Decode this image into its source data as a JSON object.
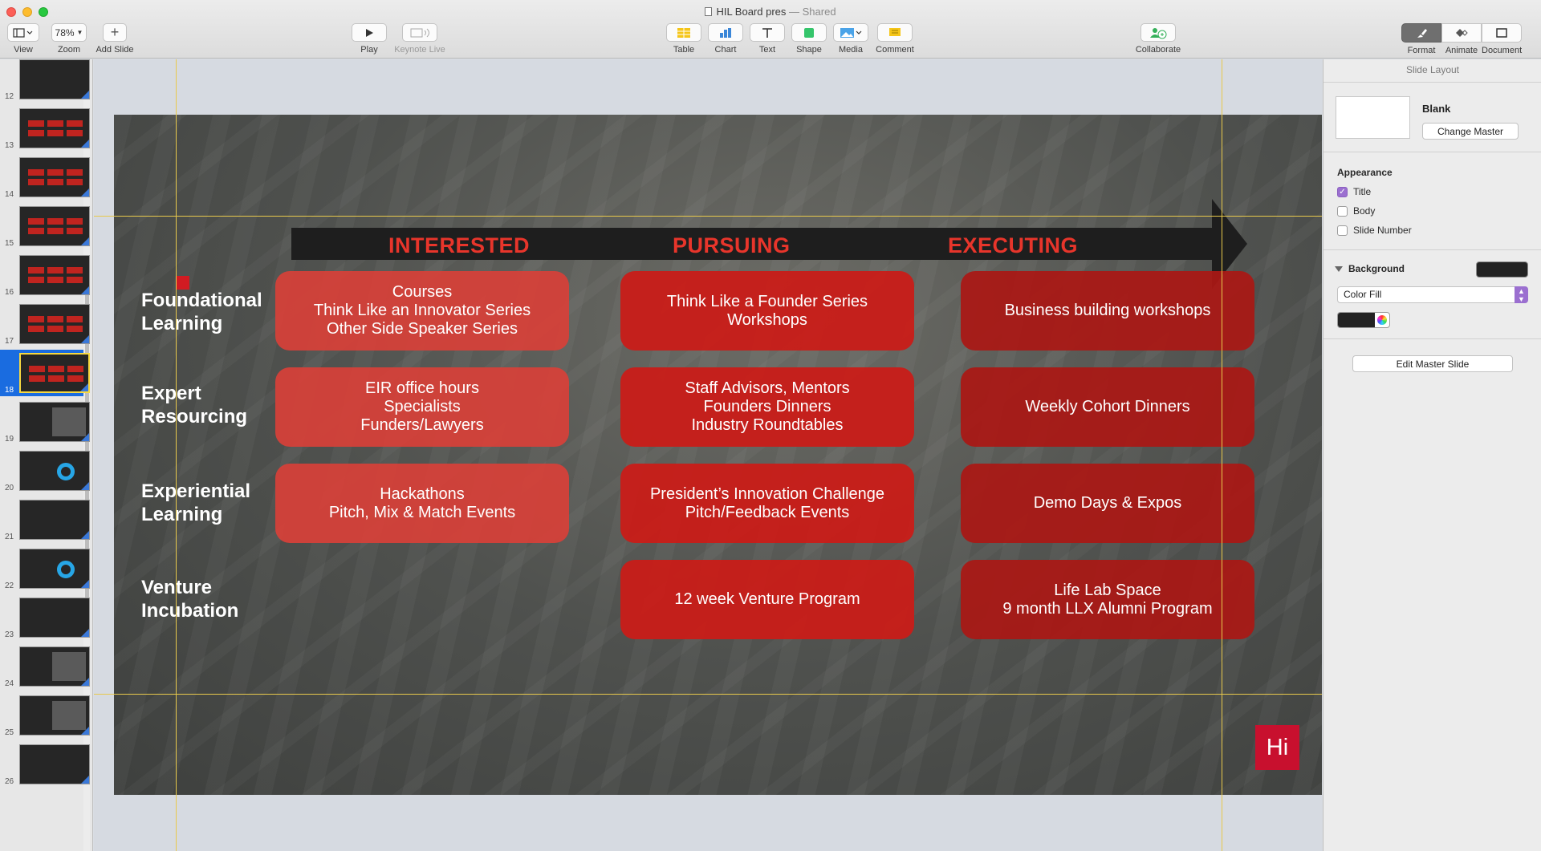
{
  "window": {
    "title": "HIL Board pres",
    "shared_status": "— Shared"
  },
  "toolbar": {
    "view_label": "View",
    "zoom_value": "78%",
    "zoom_label": "Zoom",
    "add_slide_label": "Add Slide",
    "play_label": "Play",
    "keynote_live_label": "Keynote Live",
    "table_label": "Table",
    "chart_label": "Chart",
    "text_label": "Text",
    "shape_label": "Shape",
    "media_label": "Media",
    "comment_label": "Comment",
    "collaborate_label": "Collaborate",
    "format_label": "Format",
    "animate_label": "Animate",
    "document_label": "Document"
  },
  "navigator": {
    "slides": [
      {
        "num": "12"
      },
      {
        "num": "13"
      },
      {
        "num": "14"
      },
      {
        "num": "15"
      },
      {
        "num": "16"
      },
      {
        "num": "17"
      },
      {
        "num": "18",
        "selected": true
      },
      {
        "num": "19"
      },
      {
        "num": "20"
      },
      {
        "num": "21"
      },
      {
        "num": "22"
      },
      {
        "num": "23"
      },
      {
        "num": "24"
      },
      {
        "num": "25"
      },
      {
        "num": "26"
      }
    ]
  },
  "slide": {
    "phases": [
      "INTERESTED",
      "PURSUING",
      "EXECUTING"
    ],
    "rows": [
      {
        "label": [
          "Foundational",
          "Learning"
        ],
        "cells": [
          [
            "Courses",
            "Think Like an Innovator Series",
            "Other Side Speaker Series"
          ],
          [
            "Think Like a Founder Series",
            "Workshops"
          ],
          [
            "Business building workshops"
          ]
        ]
      },
      {
        "label": [
          "Expert",
          "Resourcing"
        ],
        "cells": [
          [
            "EIR office hours",
            "Specialists",
            "Funders/Lawyers"
          ],
          [
            "Staff Advisors, Mentors",
            "Founders Dinners",
            "Industry Roundtables"
          ],
          [
            "Weekly Cohort Dinners"
          ]
        ]
      },
      {
        "label": [
          "Experiential",
          "Learning"
        ],
        "cells": [
          [
            "Hackathons",
            "Pitch, Mix & Match Events"
          ],
          [
            "President’s Innovation Challenge",
            "Pitch/Feedback Events"
          ],
          [
            "Demo Days & Expos"
          ]
        ]
      },
      {
        "label": [
          "Venture",
          "Incubation"
        ],
        "cells": [
          [],
          [
            "12 week Venture Program"
          ],
          [
            "Life Lab Space",
            "9 month LLX Alumni Program"
          ]
        ]
      }
    ],
    "logo_text": "Hi"
  },
  "inspector": {
    "panel_title": "Slide Layout",
    "master_name": "Blank",
    "change_master_label": "Change Master",
    "appearance_heading": "Appearance",
    "title_option": "Title",
    "title_checked": true,
    "body_option": "Body",
    "body_checked": false,
    "slide_number_option": "Slide Number",
    "slide_number_checked": false,
    "background_heading": "Background",
    "fill_type": "Color Fill",
    "background_color": "#232323",
    "edit_master_label": "Edit Master Slide"
  }
}
